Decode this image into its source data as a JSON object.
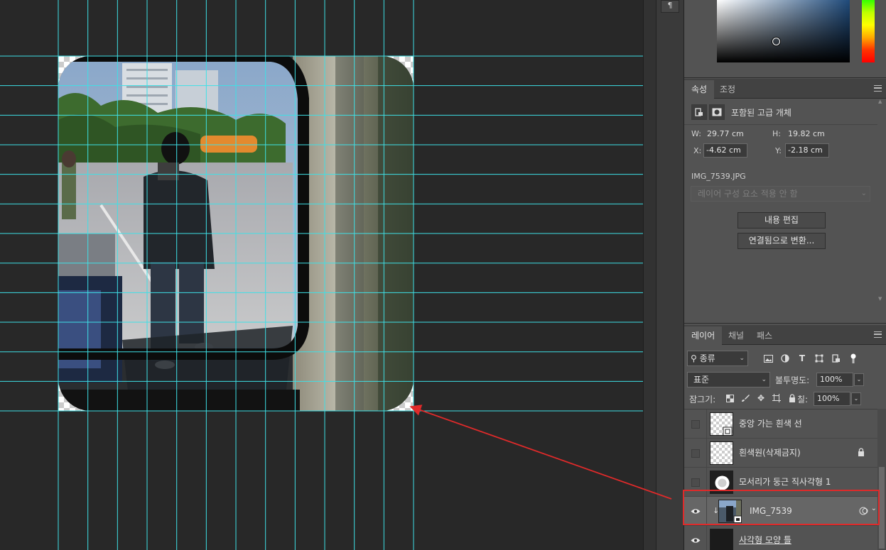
{
  "collapsed_panel": {
    "icon": "paragraph-icon"
  },
  "properties": {
    "tabs": [
      {
        "label": "속성",
        "active": true
      },
      {
        "label": "조정",
        "active": false
      }
    ],
    "object_type": "포함된 고급 개체",
    "w_label": "W:",
    "w_value": "29.77 cm",
    "h_label": "H:",
    "h_value": "19.82 cm",
    "x_label": "X:",
    "x_value": "-4.62 cm",
    "y_label": "Y:",
    "y_value": "-2.18 cm",
    "file_name": "IMG_7539.JPG",
    "comp_placeholder": "레이어 구성 요소 적용 안 함",
    "edit_contents": "내용 편집",
    "convert_linked": "연결됨으로 변환..."
  },
  "layers_panel": {
    "tabs": [
      {
        "label": "레이어",
        "active": true
      },
      {
        "label": "채널",
        "active": false
      },
      {
        "label": "패스",
        "active": false
      }
    ],
    "kind_filter": "종류",
    "blend_mode": "표준",
    "opacity_label": "불투명도:",
    "opacity_value": "100%",
    "lock_label": "잠그기:",
    "fill_label": "칠:",
    "fill_value": "100%",
    "layers": [
      {
        "name": "중앙 가는 흰색 선",
        "visible": false,
        "thumb": "checker-frame",
        "locked": false,
        "selected": false
      },
      {
        "name": "흰색원(삭제금지)",
        "visible": false,
        "thumb": "checker",
        "locked": true,
        "selected": false
      },
      {
        "name": "모서리가 둥근 직사각형 1",
        "visible": false,
        "thumb": "shape",
        "locked": false,
        "selected": false
      },
      {
        "name": "IMG_7539",
        "visible": true,
        "thumb": "photo",
        "locked": false,
        "selected": true
      },
      {
        "name": "사각형 모양 틀",
        "visible": true,
        "thumb": "dark",
        "locked": false,
        "selected": false
      }
    ]
  },
  "colors": {
    "guide": "#3ee0e6",
    "annotation": "#e02a2a",
    "panel_bg": "#535353",
    "canvas_bg": "#282828",
    "selected_row": "#666666"
  }
}
